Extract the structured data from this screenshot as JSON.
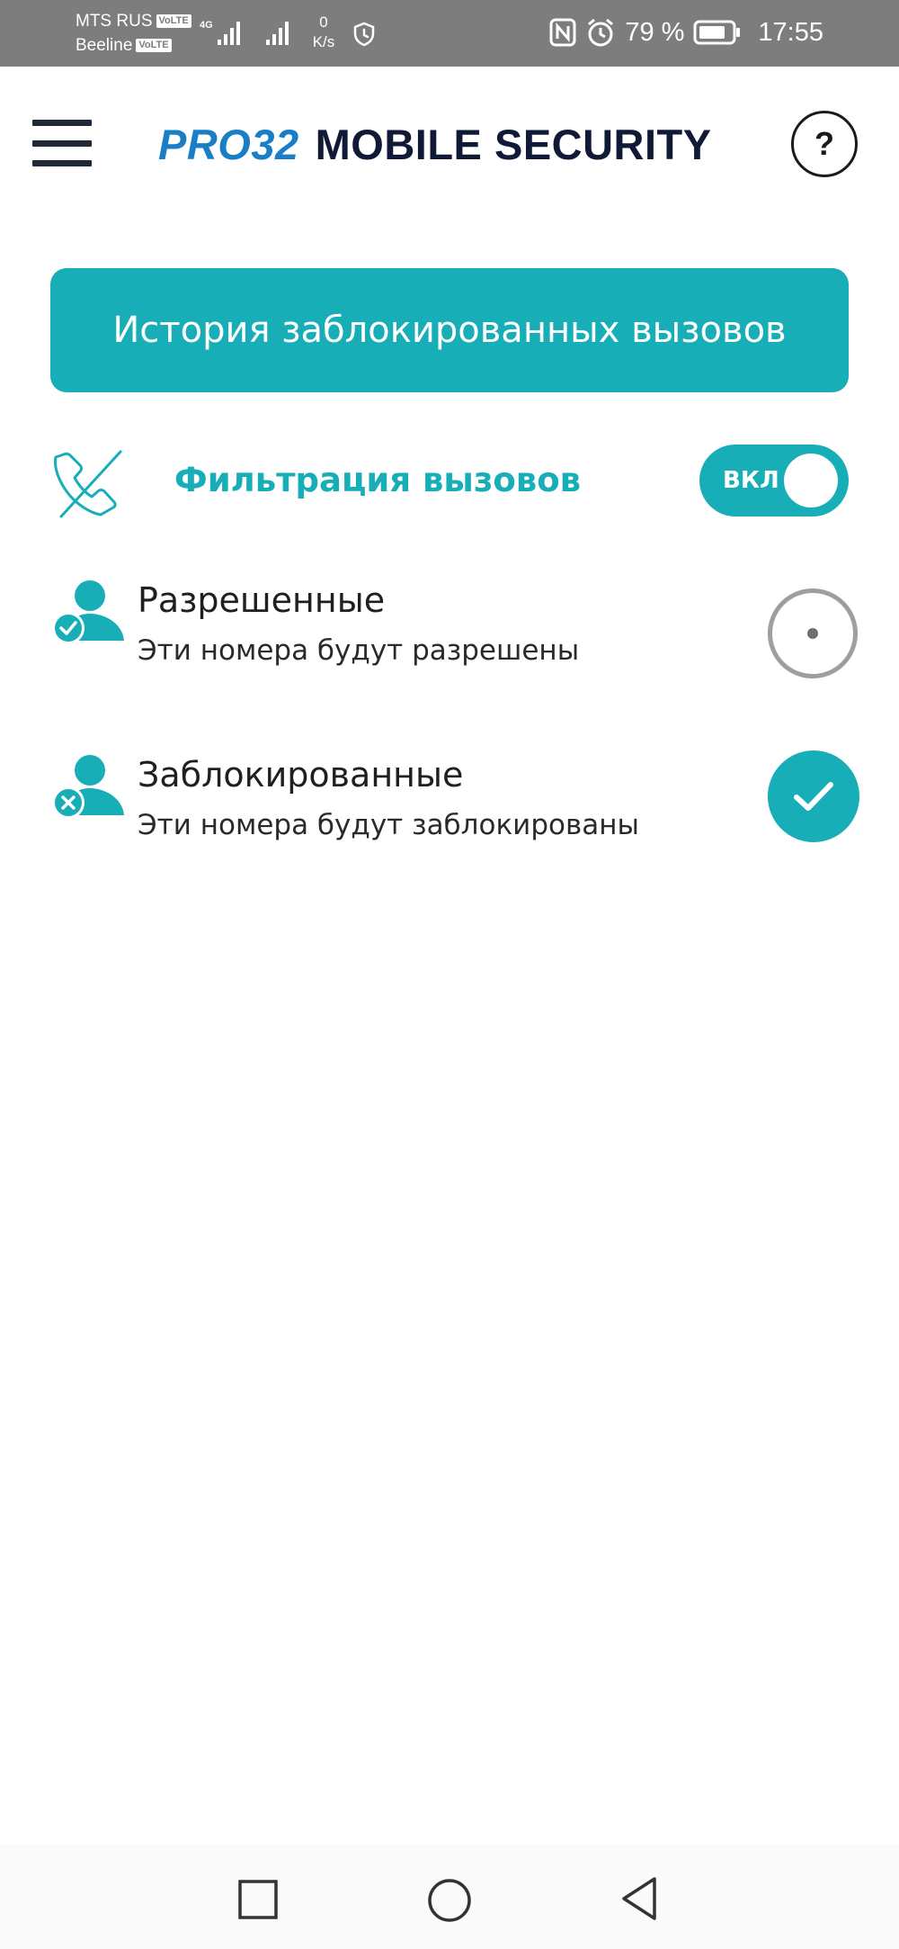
{
  "status_bar": {
    "carrier1": "MTS RUS",
    "carrier2": "Beeline",
    "volte": "VoLTE",
    "network_type": "4G",
    "net_speed_value": "0",
    "net_speed_unit": "K/s",
    "battery_percent": "79 %",
    "time": "17:55"
  },
  "header": {
    "logo_brand": "PRO32",
    "logo_product": "MOBILE SECURITY",
    "help_label": "?"
  },
  "main": {
    "history_button_label": "История заблокированных вызовов",
    "filter": {
      "label": "Фильтрация вызовов",
      "toggle_label": "ВКЛ",
      "enabled": true
    },
    "options": [
      {
        "title": "Разрешенные",
        "subtitle": "Эти номера будут разрешены",
        "selected": false
      },
      {
        "title": "Заблокированные",
        "subtitle": "Эти номера будут заблокированы",
        "selected": true
      }
    ]
  },
  "colors": {
    "accent": "#17aeb8",
    "brand_blue": "#1a7ec6",
    "brand_dark": "#101a36",
    "status_bar": "#7d7d7d"
  },
  "icons": {
    "menu": "hamburger-icon",
    "help": "question-mark-icon",
    "filter": "call-blocked-icon",
    "allowed": "user-check-icon",
    "blocked": "user-x-icon",
    "nav_recent": "square-icon",
    "nav_home": "circle-icon",
    "nav_back": "triangle-back-icon"
  }
}
